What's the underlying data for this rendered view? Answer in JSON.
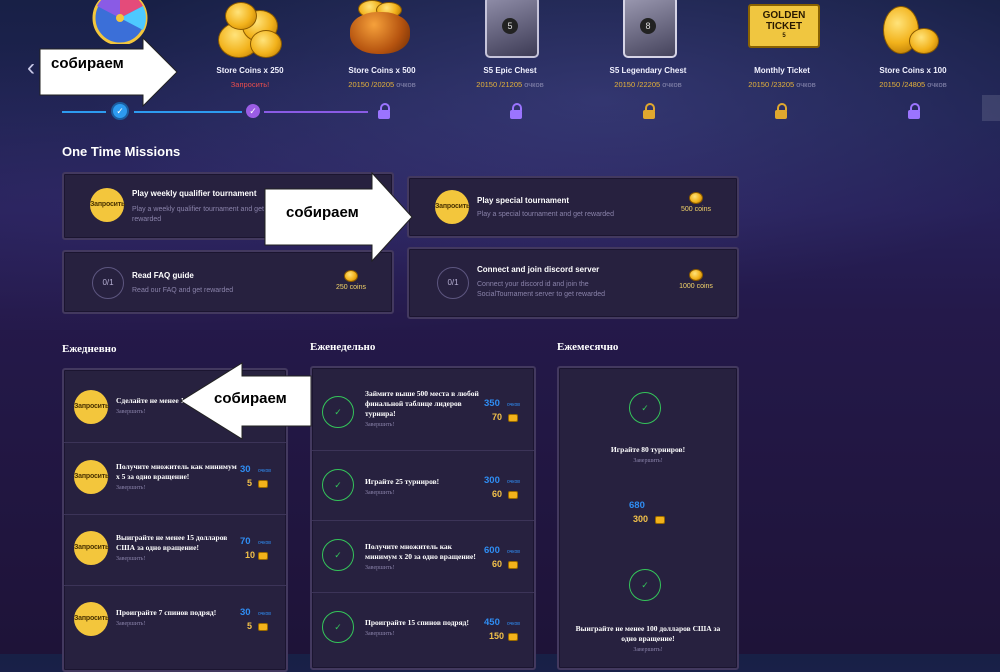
{
  "rewards": [
    {
      "name": "",
      "sub": ""
    },
    {
      "name": "Store Coins x 250",
      "sub": "Запросить!"
    },
    {
      "name": "Store Coins x 500",
      "sub": "20150 /20205",
      "unit": "очков"
    },
    {
      "name": "S5 Epic Chest",
      "sub": "20150 /21205",
      "unit": "очков"
    },
    {
      "name": "S5 Legendary Chest",
      "sub": "20150 /22205",
      "unit": "очков"
    },
    {
      "name": "Monthly Ticket",
      "sub": "20150 /23205",
      "unit": "очков"
    },
    {
      "name": "Store Coins x 100",
      "sub": "20150 /24805",
      "unit": "очков"
    }
  ],
  "ticket": {
    "line1": "GOLDEN",
    "line2": "TICKET",
    "num": "5"
  },
  "chest_numbers": {
    "epic": "5",
    "legendary": "8"
  },
  "one_time": {
    "title": "One Time Missions",
    "missions": [
      {
        "title": "Play weekly qualifier tournament",
        "desc": "Play a weekly qualifier tournament and get rewarded",
        "state": "Запросить",
        "reward": ""
      },
      {
        "title": "Play special tournament",
        "desc": "Play a special tournament and get rewarded",
        "state": "Запросить",
        "reward": "500 coins"
      },
      {
        "title": "Read FAQ guide",
        "desc": "Read our FAQ and get rewarded",
        "state": "0/1",
        "reward": "250 coins"
      },
      {
        "title": "Connect and join discord server",
        "desc": "Connect your discord id and join the SocialTournament server to get rewarded",
        "state": "0/1",
        "reward": "1000 coins"
      }
    ]
  },
  "daily": {
    "title": "Ежедневно",
    "missions": [
      {
        "title": "Сделайте не менее 1",
        "sub": "Завершить!",
        "btn": "Запросить",
        "points": "",
        "coins": ""
      },
      {
        "title": "Получите множитель как минимум х 5 за одно вращение!",
        "sub": "Завершить!",
        "btn": "Запросить",
        "points": "30",
        "coins": "5"
      },
      {
        "title": "Выиграйте не менее 15 долларов США за одно вращение!",
        "sub": "Завершить!",
        "btn": "Запросить",
        "points": "70",
        "coins": "10"
      },
      {
        "title": "Проиграйте 7 спинов подряд!",
        "sub": "Завершить!",
        "btn": "Запросить",
        "points": "30",
        "coins": "5"
      }
    ]
  },
  "weekly": {
    "title": "Еженедельно",
    "missions": [
      {
        "title": "Займите выше 500 места в любой финальной таблице лидеров турнира!",
        "sub": "Завершить!",
        "points": "350",
        "coins": "70"
      },
      {
        "title": "Играйте 25 турниров!",
        "sub": "Завершить!",
        "points": "300",
        "coins": "60"
      },
      {
        "title": "Получите множитель как минимум х 20 за одно вращение!",
        "sub": "Завершить!",
        "points": "600",
        "coins": "60"
      },
      {
        "title": "Проиграйте 15 спинов подряд!",
        "sub": "Завершить!",
        "points": "450",
        "coins": "150"
      }
    ]
  },
  "monthly": {
    "title": "Ежемесячно",
    "missions": [
      {
        "title": "Играйте 80 турниров!",
        "sub": "Завершить!",
        "points": "680",
        "coins": "300"
      },
      {
        "title": "Выиграйте не менее 100 долларов США за одно вращение!",
        "sub": "Завершить!",
        "points": "",
        "coins": ""
      }
    ]
  },
  "points_unit": "очков",
  "check_glyph": "✓",
  "annotations": [
    "собираем",
    "собираем",
    "собираем"
  ],
  "colors": {
    "accent_blue": "#2d9bf0",
    "accent_purple": "#9b5de5",
    "gold": "#f3c63c",
    "claimed_red": "#e84d4d",
    "success_green": "#34c55a"
  }
}
